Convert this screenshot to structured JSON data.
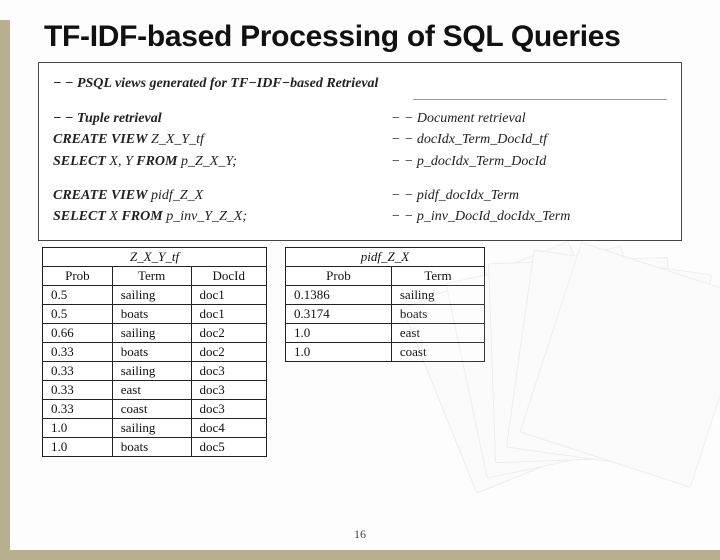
{
  "title": "TF-IDF-based Processing of SQL Queries",
  "code": {
    "line1_left": "− −  PSQL views generated for TF−IDF−based Retrieval",
    "row2_left": "− −  Tuple retrieval",
    "row2_right": "− −  Document retrieval",
    "row3_left_kw": "CREATE VIEW",
    "row3_left_rest": " Z_X_Y_tf",
    "row3_right": "− −  docIdx_Term_DocId_tf",
    "row4_left_kw1": "SELECT",
    "row4_left_mid": " X, Y ",
    "row4_left_kw2": "FROM",
    "row4_left_rest": " p_Z_X_Y;",
    "row4_right": "− −  p_docIdx_Term_DocId",
    "row5_left_kw": "CREATE VIEW",
    "row5_left_rest": " pidf_Z_X",
    "row5_right": "− −  pidf_docIdx_Term",
    "row6_left_kw1": "SELECT",
    "row6_left_mid": " X ",
    "row6_left_kw2": "FROM",
    "row6_left_rest": " p_inv_Y_Z_X;",
    "row6_right": "− −  p_inv_DocId_docIdx_Term"
  },
  "table1": {
    "caption": "Z_X_Y_tf",
    "headers": [
      "Prob",
      "Term",
      "DocId"
    ],
    "rows": [
      [
        "0.5",
        "sailing",
        "doc1"
      ],
      [
        "0.5",
        "boats",
        "doc1"
      ],
      [
        "0.66",
        "sailing",
        "doc2"
      ],
      [
        "0.33",
        "boats",
        "doc2"
      ],
      [
        "0.33",
        "sailing",
        "doc3"
      ],
      [
        "0.33",
        "east",
        "doc3"
      ],
      [
        "0.33",
        "coast",
        "doc3"
      ],
      [
        "1.0",
        "sailing",
        "doc4"
      ],
      [
        "1.0",
        "boats",
        "doc5"
      ]
    ]
  },
  "table2": {
    "caption": "pidf_Z_X",
    "headers": [
      "Prob",
      "Term"
    ],
    "rows": [
      [
        "0.1386",
        "sailing"
      ],
      [
        "0.3174",
        "boats"
      ],
      [
        "1.0",
        "east"
      ],
      [
        "1.0",
        "coast"
      ]
    ]
  },
  "page_number": "16"
}
